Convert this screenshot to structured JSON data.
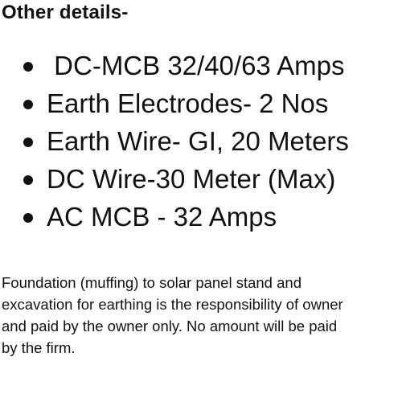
{
  "heading": "Other details-",
  "details": [
    " DC-MCB 32/40/63 Amps",
    "Earth Electrodes- 2 Nos",
    "Earth Wire- GI, 20 Meters",
    "DC Wire-30 Meter (Max)",
    "AC MCB - 32 Amps"
  ],
  "note_lines": [
    "Foundation (muffing) to solar panel stand and",
    "excavation for earthing is the responsibility of owner",
    "and paid by the owner only. No amount will be paid",
    "by the firm."
  ]
}
